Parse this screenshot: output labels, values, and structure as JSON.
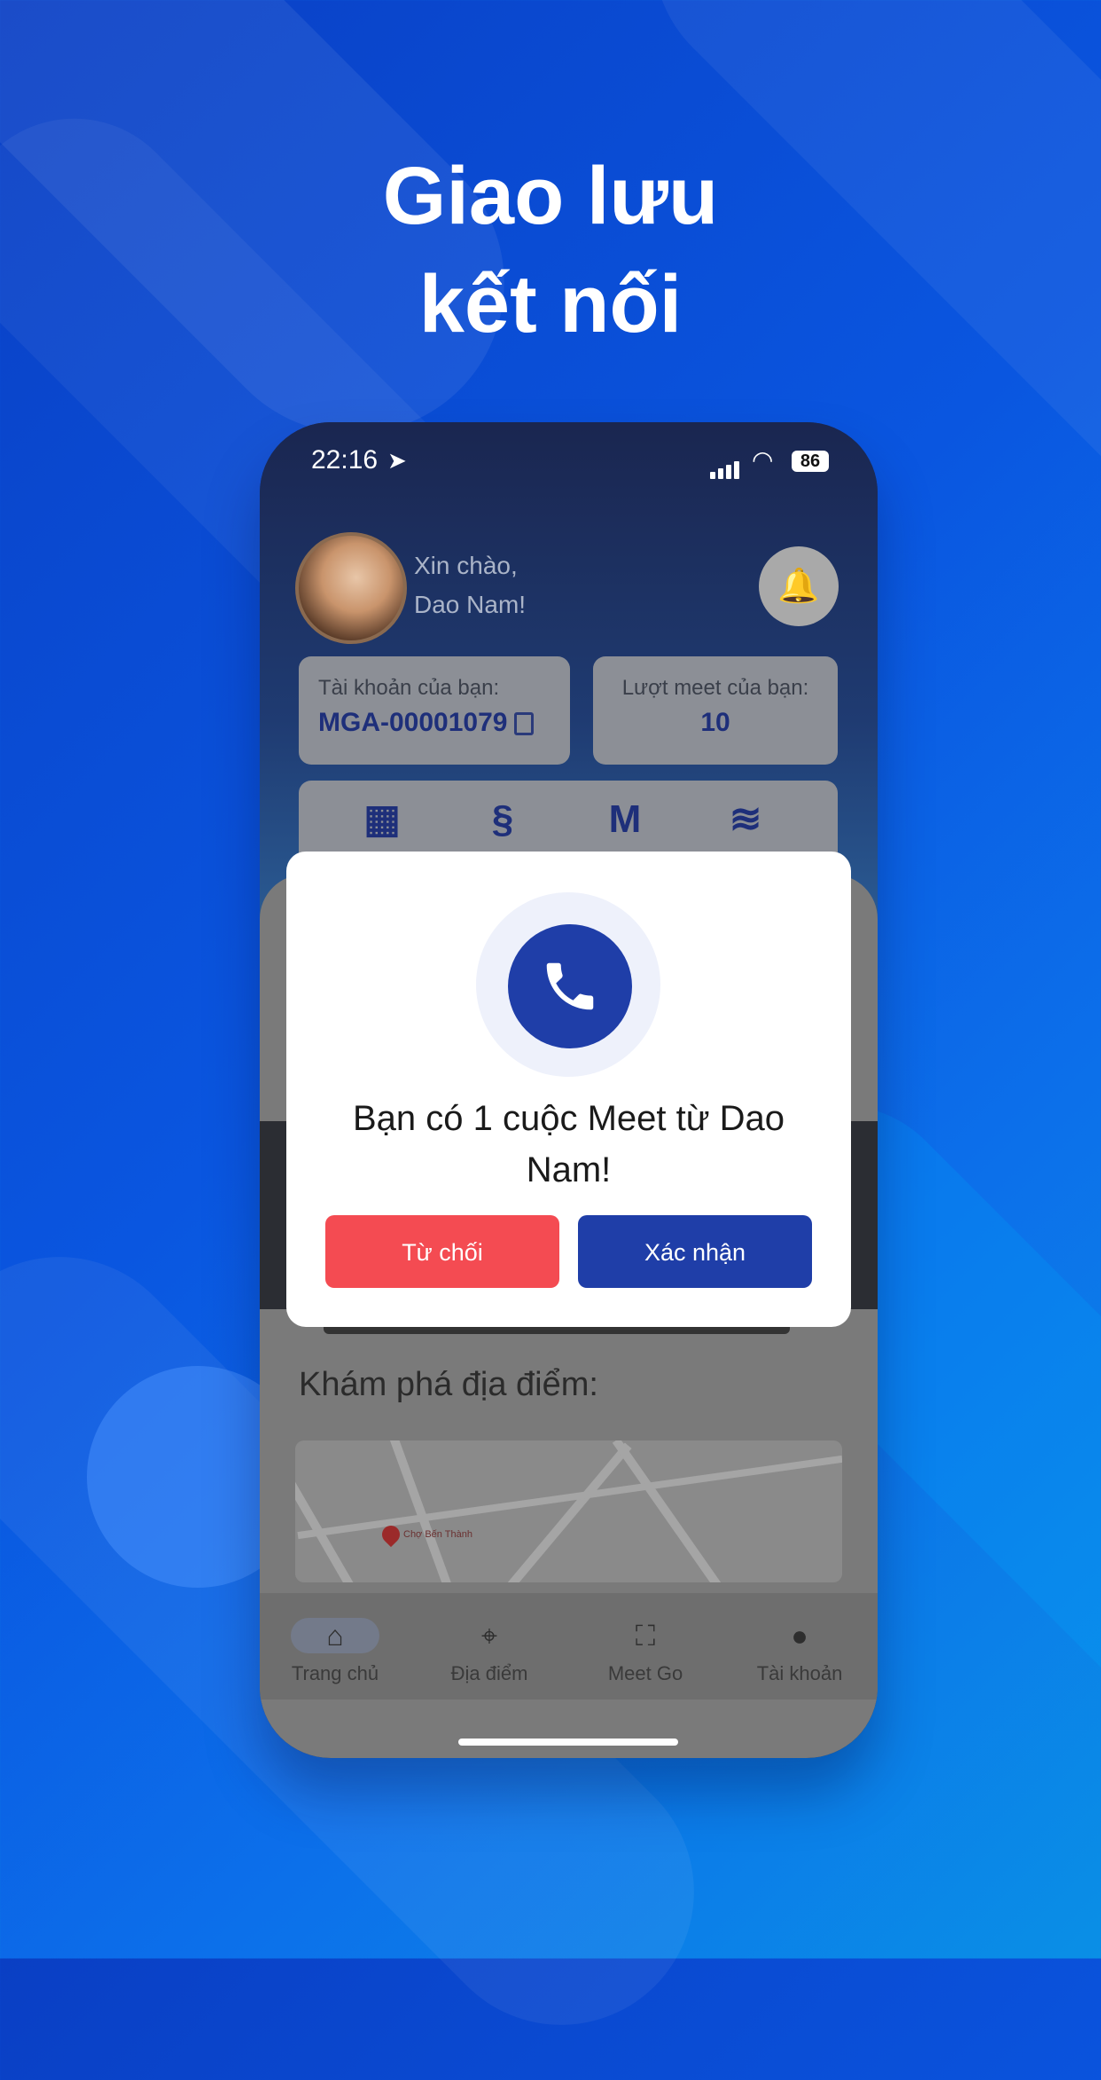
{
  "headline": {
    "line1": "Giao lưu",
    "line2": "kết nối"
  },
  "status_bar": {
    "time": "22:16",
    "battery": "86"
  },
  "header": {
    "greeting_line1": "Xin chào,",
    "greeting_line2": "Dao Nam!"
  },
  "account_card": {
    "label": "Tài khoản của bạn:",
    "value": "MGA-00001079"
  },
  "meet_card": {
    "label": "Lượt meet của bạn:",
    "value": "10"
  },
  "explore": {
    "title": "Khám phá địa điểm:"
  },
  "map": {
    "pin_label": "Chợ Bến Thành"
  },
  "tabs": [
    {
      "label": "Trang chủ",
      "icon": "home-icon"
    },
    {
      "label": "Địa điểm",
      "icon": "location-pin-icon"
    },
    {
      "label": "Meet Go",
      "icon": "scan-icon"
    },
    {
      "label": "Tài khoản",
      "icon": "user-icon"
    }
  ],
  "dialog": {
    "message": "Bạn có 1 cuộc Meet từ Dao Nam!",
    "reject_label": "Từ chối",
    "confirm_label": "Xác nhận"
  },
  "colors": {
    "primary": "#1f3ea8",
    "reject": "#f44b52",
    "background": "#0a56e0"
  }
}
